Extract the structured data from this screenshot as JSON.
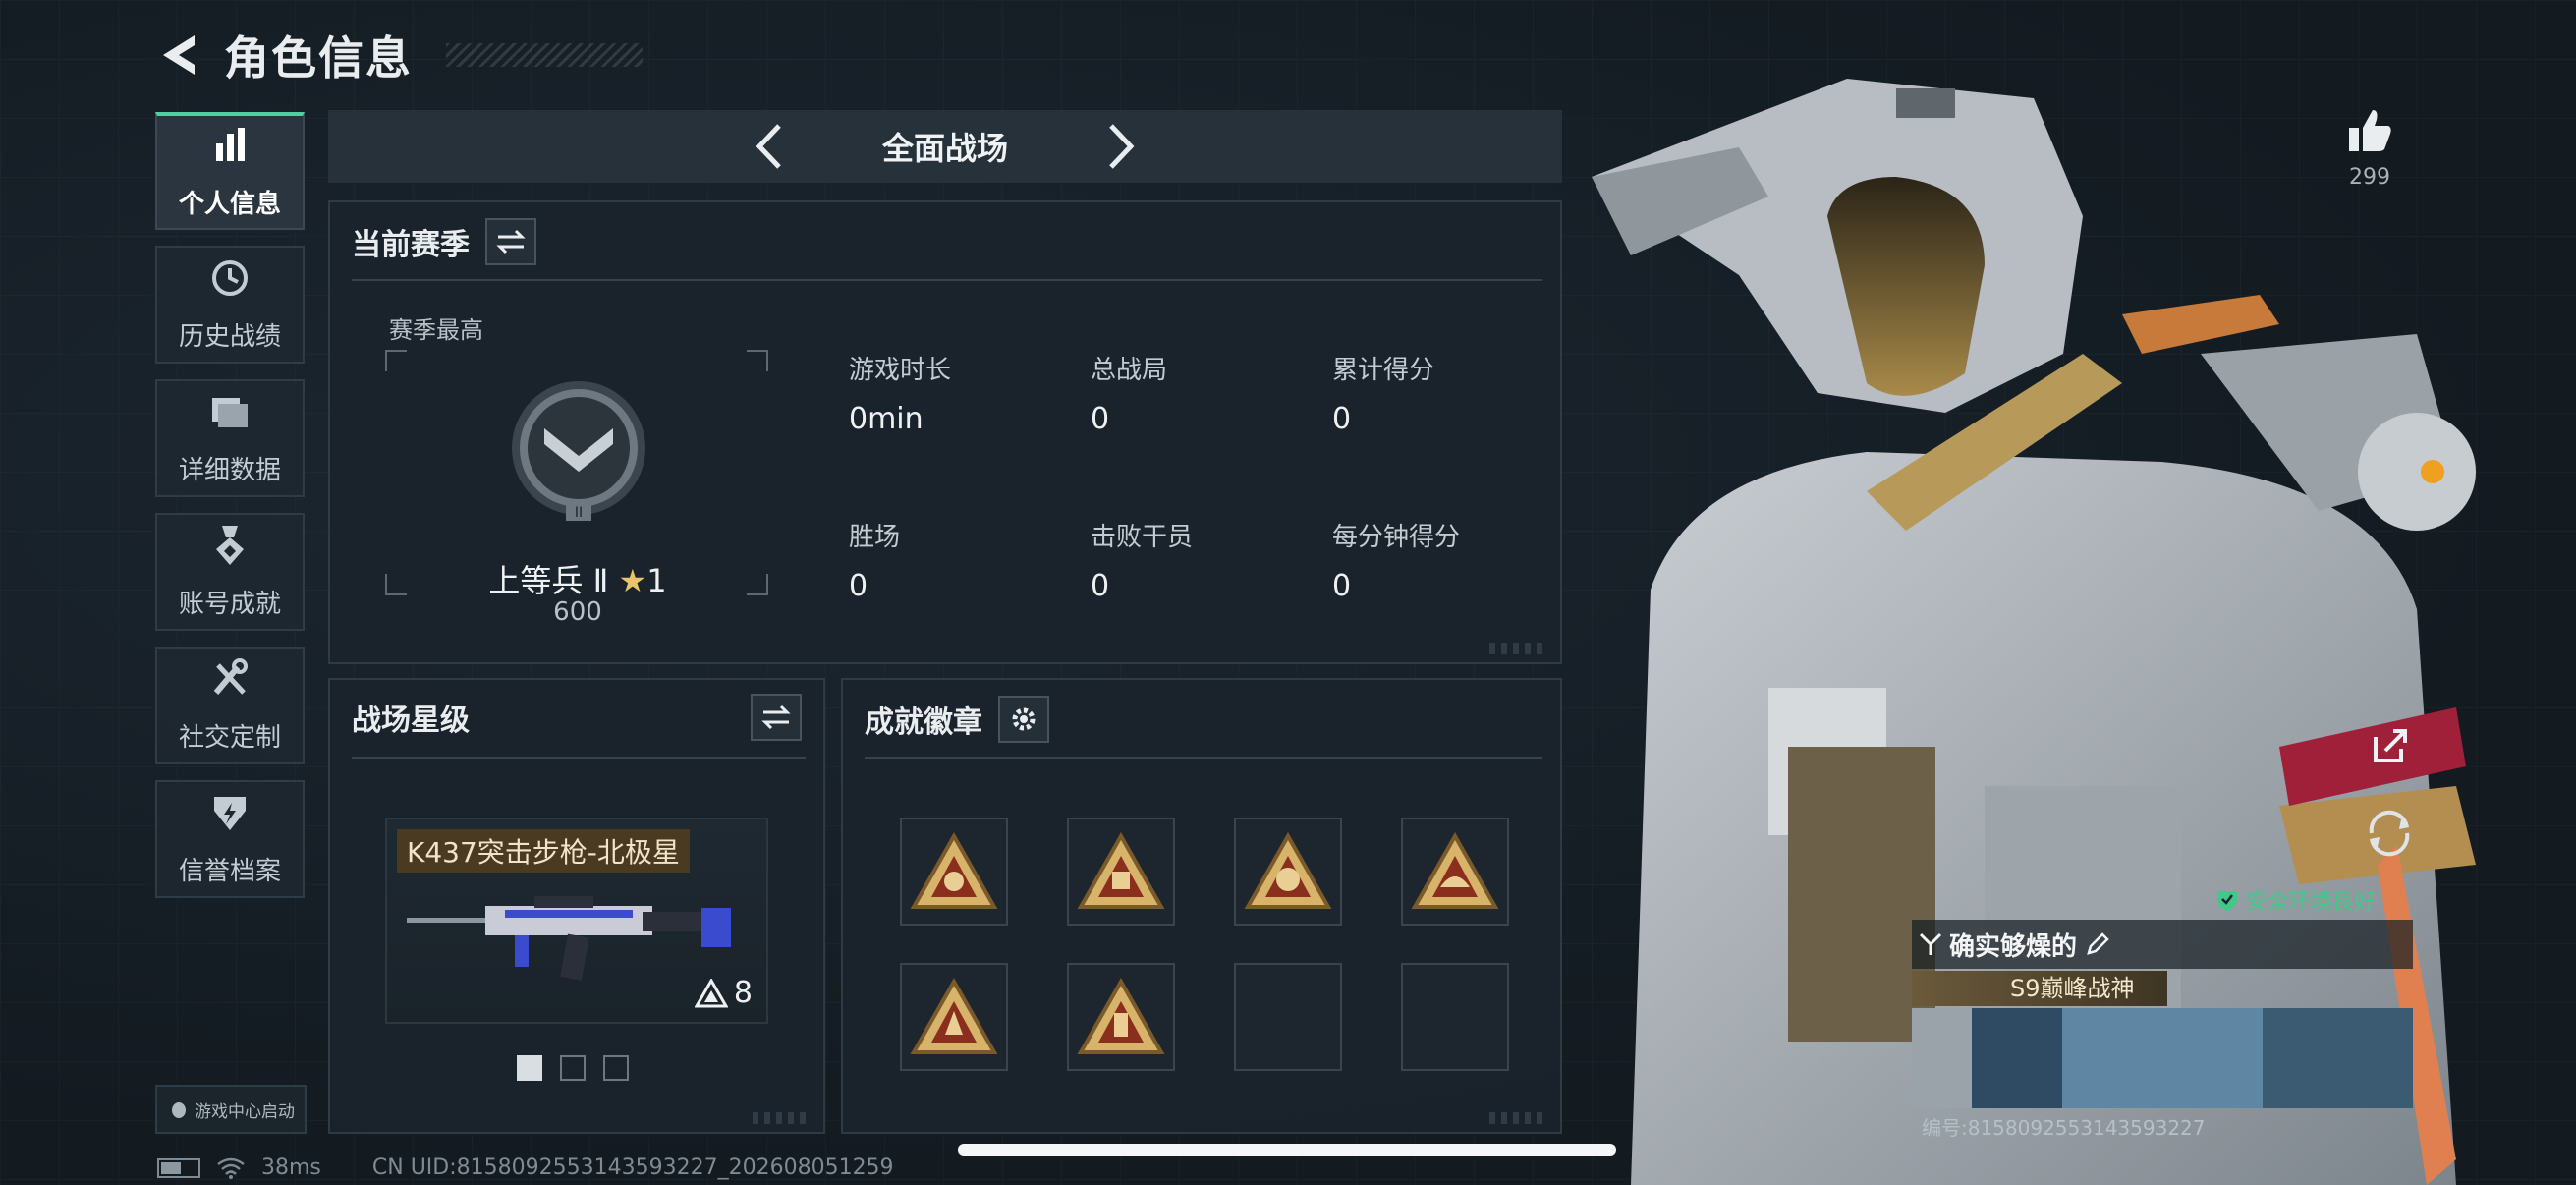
{
  "header": {
    "title": "角色信息",
    "back_icon": "back-arrow-icon"
  },
  "sidebar": {
    "items": [
      {
        "label": "个人信息",
        "icon": "bar-chart-icon",
        "active": true
      },
      {
        "label": "历史战绩",
        "icon": "history-clock-icon",
        "active": false
      },
      {
        "label": "详细数据",
        "icon": "folder-icon",
        "active": false
      },
      {
        "label": "账号成就",
        "icon": "medal-icon",
        "active": false
      },
      {
        "label": "社交定制",
        "icon": "tools-icon",
        "active": false
      },
      {
        "label": "信誉档案",
        "icon": "shield-icon",
        "active": false
      }
    ],
    "game_center": "游戏中心启动"
  },
  "mode_bar": {
    "label": "全面战场"
  },
  "season_panel": {
    "title": "当前赛季",
    "season_best": "赛季最高",
    "rank_name": "上等兵 Ⅱ",
    "rank_stars": "1",
    "rank_points": "600",
    "stats": [
      {
        "label": "游戏时长",
        "value": "0min"
      },
      {
        "label": "总战局",
        "value": "0"
      },
      {
        "label": "累计得分",
        "value": "0"
      },
      {
        "label": "胜场",
        "value": "0"
      },
      {
        "label": "击败干员",
        "value": "0"
      },
      {
        "label": "每分钟得分",
        "value": "0"
      }
    ]
  },
  "battlefield_panel": {
    "title": "战场星级",
    "weapon_name": "K437突击步枪-北极星",
    "weapon_level": "8",
    "pages": 3,
    "active_page": 1
  },
  "badges_panel": {
    "title": "成就徽章",
    "badges": [
      "gold-badge-icon",
      "gold-badge-icon",
      "gold-badge-icon",
      "gold-badge-icon",
      "gold-badge-icon",
      "gold-badge-icon",
      "empty",
      "empty"
    ]
  },
  "profile": {
    "likes": "299",
    "safe_env": "安全环境良好",
    "player_name": "确实够燥的",
    "player_title": "S9巅峰战神",
    "card_uid": "编号:8158092553143593227"
  },
  "footer": {
    "ping": "38ms",
    "uid": "CN UID:8158092553143593227_202608051259"
  },
  "colors": {
    "accent": "#4fd0a0",
    "gold": "#e8c46a",
    "panel": "#1b242c"
  }
}
